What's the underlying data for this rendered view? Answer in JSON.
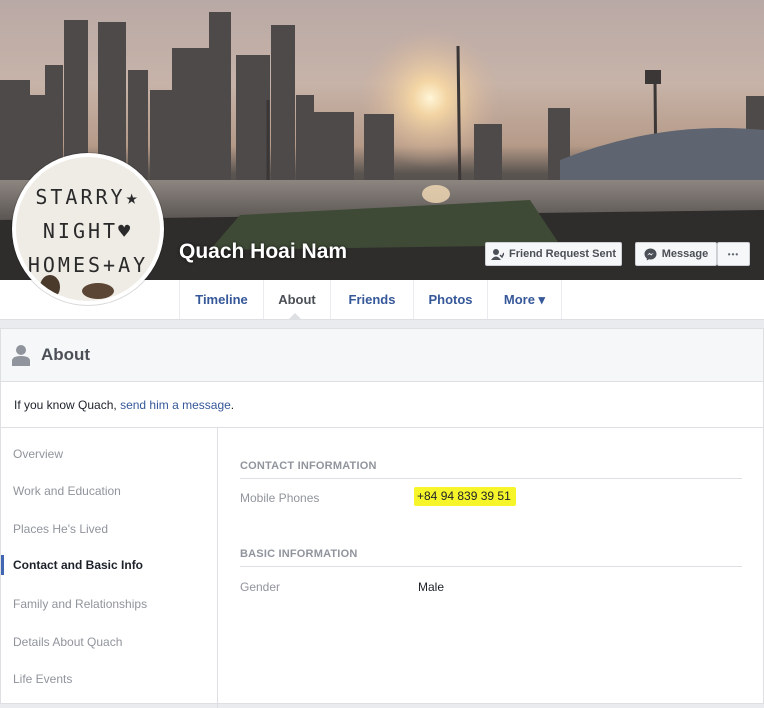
{
  "profile": {
    "name": "Quach Hoai Nam",
    "avatar_lines": [
      "STARRY★",
      "NIGHT♥",
      "HOMES+AY"
    ]
  },
  "cover_actions": {
    "friend_request": "Friend Request Sent",
    "message": "Message",
    "more": "•••"
  },
  "tabs": [
    {
      "label": "Timeline"
    },
    {
      "label": "About"
    },
    {
      "label": "Friends"
    },
    {
      "label": "Photos"
    },
    {
      "label": "More ▾"
    }
  ],
  "about": {
    "title": "About",
    "know_prefix": "If you know Quach, ",
    "know_link": "send him a message",
    "know_suffix": "."
  },
  "nav": [
    {
      "label": "Overview"
    },
    {
      "label": "Work and Education"
    },
    {
      "label": "Places He's Lived"
    },
    {
      "label": "Contact and Basic Info"
    },
    {
      "label": "Family and Relationships"
    },
    {
      "label": "Details About Quach"
    },
    {
      "label": "Life Events"
    }
  ],
  "contact": {
    "heading": "CONTACT INFORMATION",
    "mobile_label": "Mobile Phones",
    "mobile_value": "+84 94 839 39 51"
  },
  "basic": {
    "heading": "BASIC INFORMATION",
    "gender_label": "Gender",
    "gender_value": "Male"
  },
  "colors": {
    "link": "#365899",
    "highlight": "#f5f52a",
    "nav_marker": "#4267b2"
  }
}
